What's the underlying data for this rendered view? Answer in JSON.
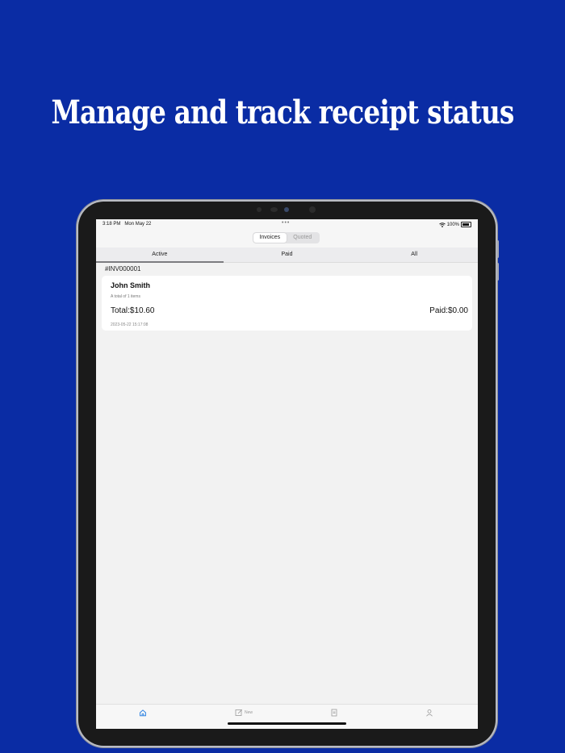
{
  "headline": "Manage and track receipt status",
  "status": {
    "time": "3:18 PM",
    "date": "Mon May 22",
    "dots": "•••",
    "battery": "100%"
  },
  "segmented": {
    "options": [
      "Invoices",
      "Quoted"
    ],
    "selected": "Invoices"
  },
  "tabs": [
    {
      "label": "Active"
    },
    {
      "label": "Paid"
    },
    {
      "label": "All"
    }
  ],
  "invoice": {
    "id": "#INV000001",
    "customer": "John Smith",
    "items": "A total of 1 items",
    "total": "Total:$10.60",
    "paid": "Paid:$0.00",
    "datetime": "2023-05-22 15:17:08"
  },
  "tabbar": {
    "new_label": "New"
  },
  "colors": {
    "background": "#0a2ca4",
    "accent": "#1f7ae0"
  }
}
